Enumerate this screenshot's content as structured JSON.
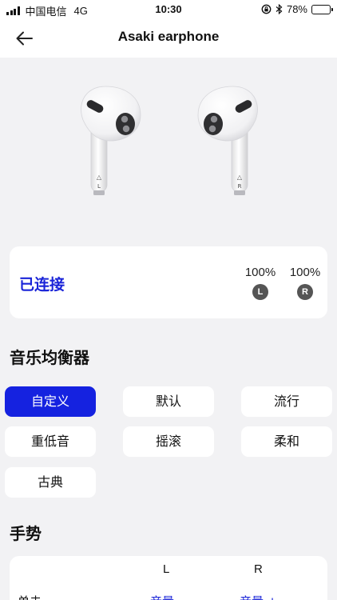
{
  "status_bar": {
    "carrier": "中国电信",
    "network": "4G",
    "time": "10:30",
    "battery": "78%",
    "battery_level": 0.78,
    "battery_color": "#4cd964"
  },
  "header": {
    "title": "Asaki earphone",
    "back_icon": "arrow-left-icon"
  },
  "earbuds": {
    "left_marker": "L",
    "right_marker": "R"
  },
  "connection": {
    "status": "已连接",
    "status_color": "#1a24d8",
    "left_battery": "100%",
    "right_battery": "100%",
    "left_label": "L",
    "right_label": "R"
  },
  "equalizer": {
    "title": "音乐均衡器",
    "active_color": "#1522e0",
    "options": [
      {
        "label": "自定义",
        "active": true
      },
      {
        "label": "默认",
        "active": false
      },
      {
        "label": "流行",
        "active": false
      },
      {
        "label": "重低音",
        "active": false
      },
      {
        "label": "摇滚",
        "active": false
      },
      {
        "label": "柔和",
        "active": false
      },
      {
        "label": "古典",
        "active": false
      }
    ]
  },
  "gestures": {
    "title": "手势",
    "col_left": "L",
    "col_right": "R",
    "rows": [
      {
        "label": "单击",
        "left": "音量 -",
        "right": "音量 +"
      }
    ]
  }
}
